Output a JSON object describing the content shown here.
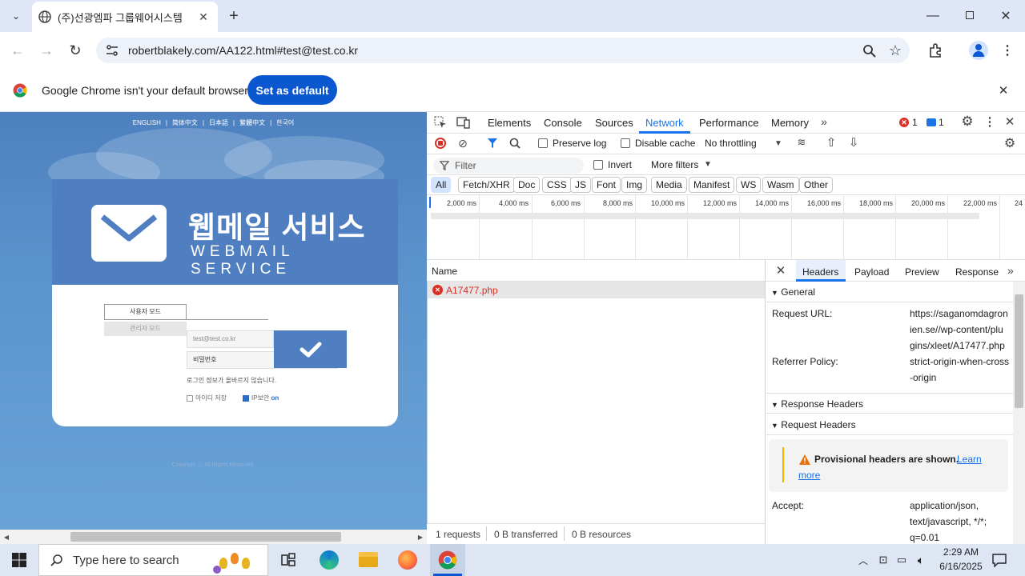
{
  "browser": {
    "tab_title": "(주)선광엠파 그룹웨어시스템",
    "url": "robertblakely.com/AA122.html#test@test.co.kr",
    "infobar_message": "Google Chrome isn't your default browser",
    "set_default_label": "Set as default"
  },
  "webpage": {
    "languages": [
      "ENGLISH",
      "|",
      "简体中文",
      "|",
      "日本語",
      "|",
      "繁體中文",
      "|",
      "한국어"
    ],
    "brand_korean": "웹메일 서비스",
    "brand_english": "WEBMAIL SERVICE",
    "user_mode": "사용자 모드",
    "admin_mode": "관리자 모드",
    "email_value": "test@test.co.kr",
    "password_placeholder": "비밀번호",
    "notice": "로그인 정보가 올바르지 않습니다.",
    "save_id_label": "아이디 저장",
    "ip_security_label": "IP보안",
    "ip_security_state": "on",
    "copyright": "Copyright ⓒ All Rights Reserved."
  },
  "devtools": {
    "tabs": [
      "Elements",
      "Console",
      "Sources",
      "Network",
      "Performance",
      "Memory"
    ],
    "active_tab": "Network",
    "error_count": "1",
    "message_count": "1",
    "preserve_log": "Preserve log",
    "disable_cache": "Disable cache",
    "throttling": "No throttling",
    "filter_placeholder": "Filter",
    "invert": "Invert",
    "more_filters": "More filters",
    "type_filters": [
      "All",
      "Fetch/XHR",
      "Doc",
      "CSS",
      "JS",
      "Font",
      "Img",
      "Media",
      "Manifest",
      "WS",
      "Wasm",
      "Other"
    ],
    "timeline_ticks": [
      "2,000 ms",
      "4,000 ms",
      "6,000 ms",
      "8,000 ms",
      "10,000 ms",
      "12,000 ms",
      "14,000 ms",
      "16,000 ms",
      "18,000 ms",
      "20,000 ms",
      "22,000 ms",
      "24"
    ],
    "name_header": "Name",
    "request_name": "A17477.php",
    "detail_tabs": [
      "Headers",
      "Payload",
      "Preview",
      "Response"
    ],
    "general_label": "General",
    "request_url_label": "Request URL:",
    "request_url_lines": [
      "https://saganomdagron",
      "ien.se//wp-content/plu",
      "gins/xleet/A17477.php"
    ],
    "referrer_label": "Referrer Policy:",
    "referrer_lines": [
      "strict-origin-when-cross",
      "-origin"
    ],
    "response_headers": "Response Headers",
    "request_headers": "Request Headers",
    "provisional_text": "Provisional headers are shown.",
    "learn_more_1": "Learn",
    "learn_more_2": "more",
    "accept_label": "Accept:",
    "accept_lines": [
      "application/json,",
      "text/javascript, */*;",
      "q=0.01"
    ],
    "status_requests": "1 requests",
    "status_transferred": "0 B transferred",
    "status_resources": "0 B resources"
  },
  "taskbar": {
    "search_placeholder": "Type here to search",
    "time": "2:29 AM",
    "date": "6/16/2025"
  },
  "colors": {
    "chrome_blue": "#0b57d0",
    "page_blue": "#4f7ec1",
    "error_red": "#d93025",
    "network_blue": "#1a73e8"
  }
}
